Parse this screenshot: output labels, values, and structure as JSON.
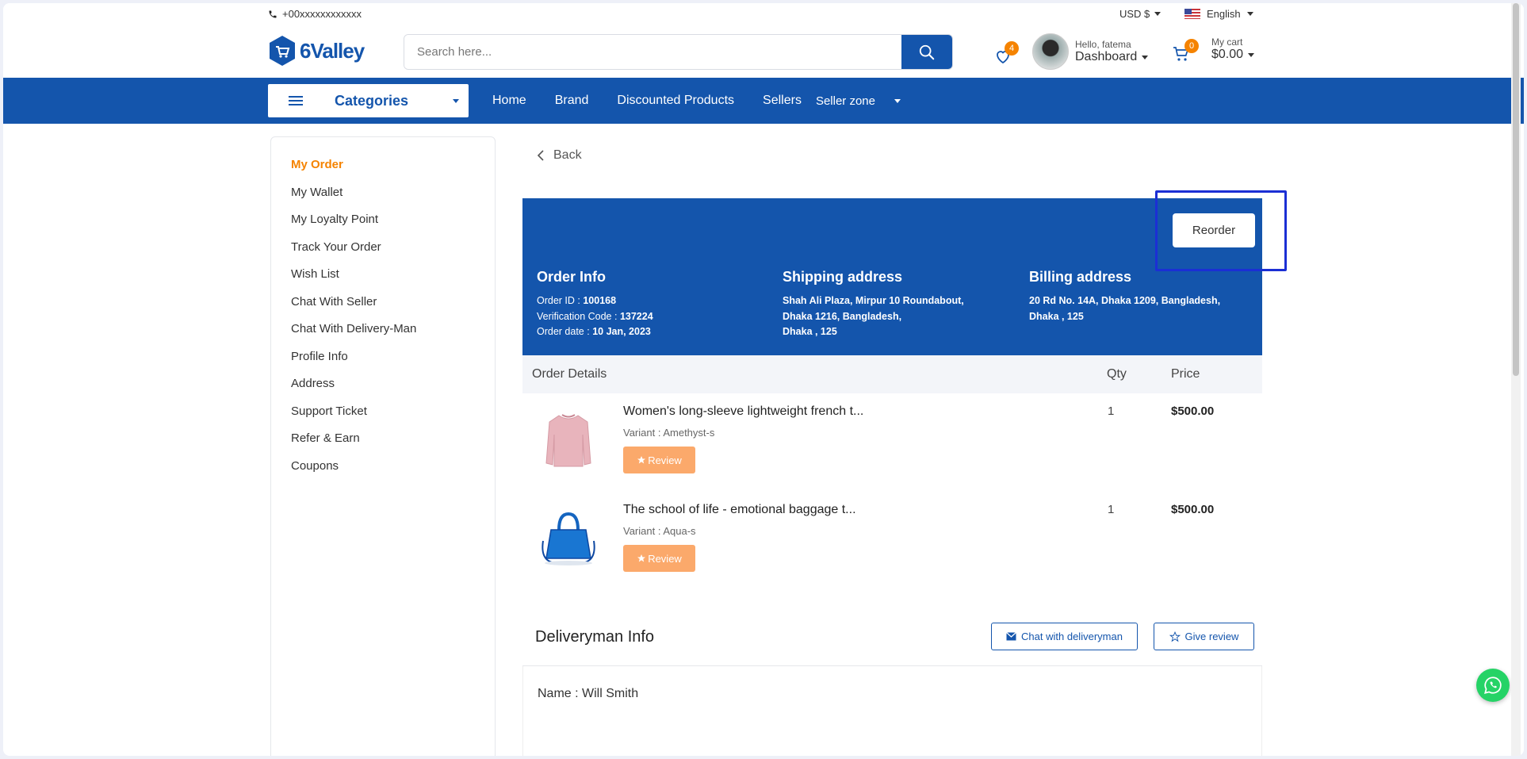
{
  "topbar": {
    "phone": "+00xxxxxxxxxxxx",
    "currency": "USD $",
    "language": "English"
  },
  "header": {
    "logo_text": "6Valley",
    "search_placeholder": "Search here...",
    "wishlist_count": "4",
    "greeting": "Hello, fatema",
    "dashboard_label": "Dashboard",
    "cart_count": "0",
    "cart_label": "My cart",
    "cart_total": "$0.00"
  },
  "nav": {
    "categories_label": "Categories",
    "links": [
      "Home",
      "Brand",
      "Discounted Products",
      "Sellers"
    ],
    "seller_zone": "Seller zone"
  },
  "sidebar": {
    "items": [
      {
        "label": "My Order",
        "active": true
      },
      {
        "label": "My Wallet"
      },
      {
        "label": "My Loyalty Point"
      },
      {
        "label": "Track Your Order"
      },
      {
        "label": "Wish List"
      },
      {
        "label": "Chat With Seller"
      },
      {
        "label": "Chat With Delivery-Man"
      },
      {
        "label": "Profile Info"
      },
      {
        "label": "Address"
      },
      {
        "label": "Support Ticket"
      },
      {
        "label": "Refer & Earn"
      },
      {
        "label": "Coupons"
      }
    ]
  },
  "main": {
    "back_label": "Back",
    "reorder_label": "Reorder",
    "order_info": {
      "title": "Order Info",
      "order_id_label": "Order ID :",
      "order_id": "100168",
      "verification_label": "Verification Code :",
      "verification_code": "137224",
      "date_label": "Order date :",
      "date": "10 Jan, 2023"
    },
    "shipping": {
      "title": "Shipping address",
      "lines": [
        "Shah Ali Plaza, Mirpur 10 Roundabout,",
        "Dhaka 1216, Bangladesh,",
        "Dhaka , 125"
      ]
    },
    "billing": {
      "title": "Billing address",
      "lines": [
        "20 Rd No. 14A, Dhaka 1209, Bangladesh,",
        "Dhaka , 125"
      ]
    },
    "details_header": {
      "details": "Order Details",
      "qty": "Qty",
      "price": "Price"
    },
    "products": [
      {
        "name": "Women's long-sleeve lightweight french t...",
        "variant": "Variant : Amethyst-s",
        "review_label": "Review",
        "qty": "1",
        "price": "$500.00",
        "thumb": "sweater"
      },
      {
        "name": "The school of life - emotional baggage t...",
        "variant": "Variant : Aqua-s",
        "review_label": "Review",
        "qty": "1",
        "price": "$500.00",
        "thumb": "handbag"
      }
    ],
    "deliveryman": {
      "title": "Deliveryman Info",
      "chat_label": "Chat with deliveryman",
      "review_label": "Give review",
      "name_line": "Name : Will Smith"
    }
  },
  "colors": {
    "primary": "#1455ac",
    "accent": "#f58300",
    "review_button": "#fba96b",
    "highlight_box": "#1b2fd4",
    "whatsapp": "#25d366"
  }
}
